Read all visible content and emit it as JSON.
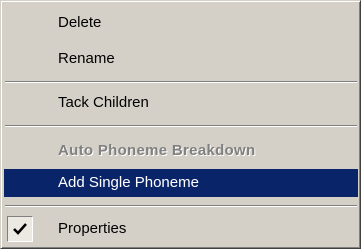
{
  "menu": {
    "items": [
      {
        "label": "Delete"
      },
      {
        "label": "Rename"
      },
      {
        "label": "Tack Children"
      },
      {
        "label": "Auto Phoneme Breakdown",
        "disabled": true
      },
      {
        "label": "Add Single Phoneme",
        "selected": true
      },
      {
        "label": "Properties",
        "checked": true
      }
    ],
    "check_icon": "checkmark-icon"
  },
  "colors": {
    "menu_face": "#d4d0c8",
    "highlight": "#0a246a",
    "highlight_text": "#ffffff",
    "disabled_text": "#808080"
  }
}
